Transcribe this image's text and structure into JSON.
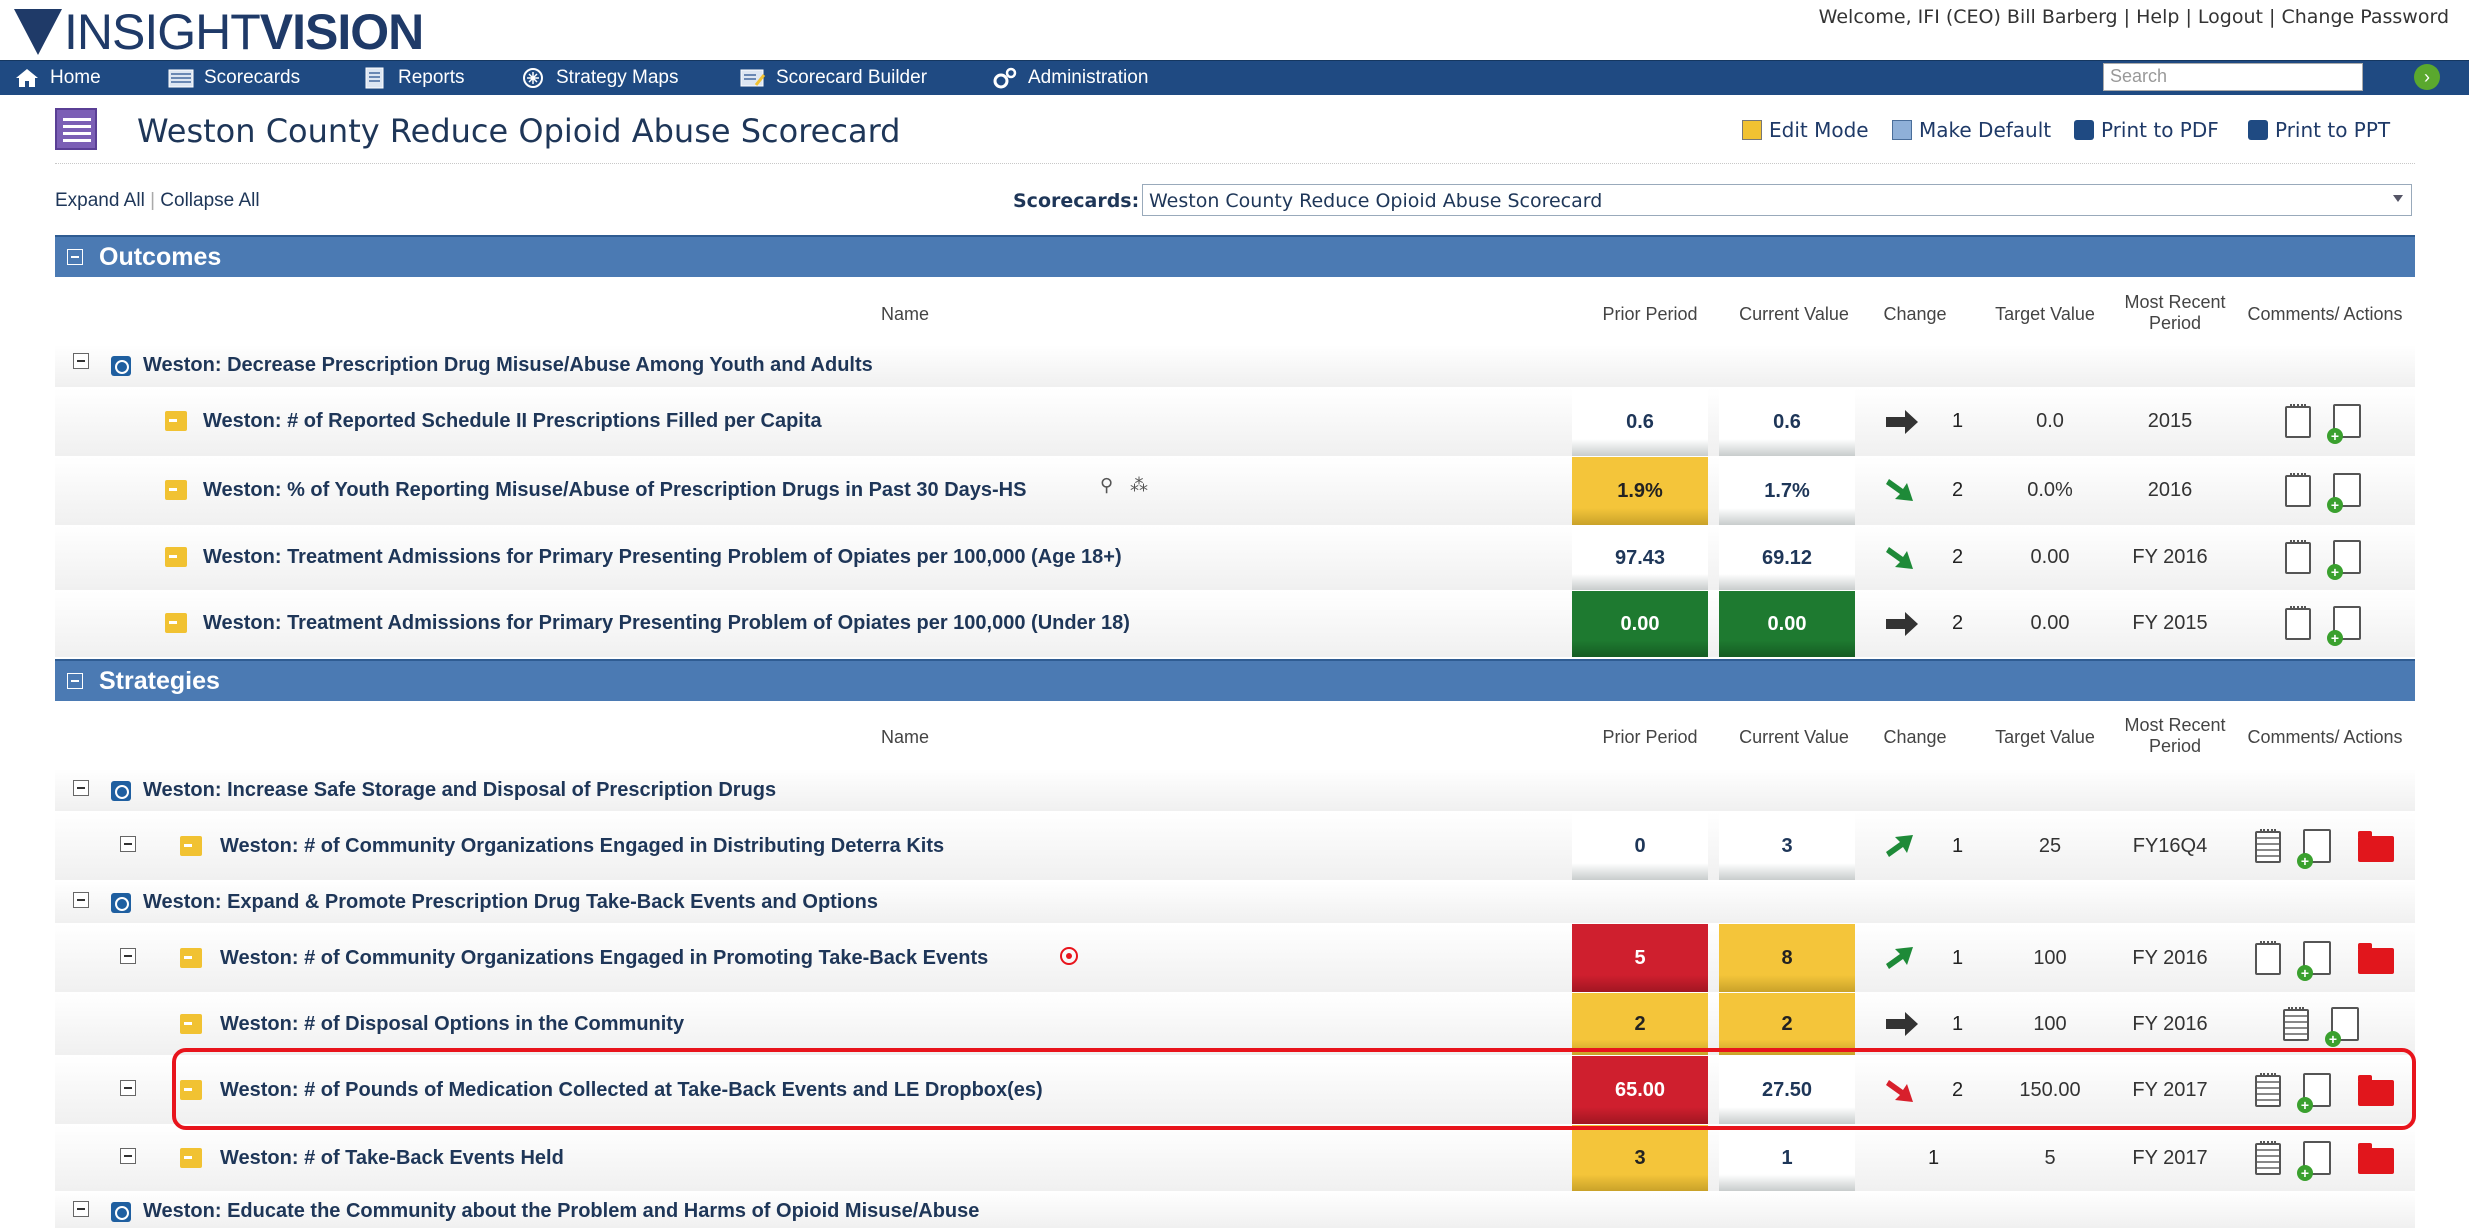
{
  "brand": {
    "logo_light": "INSIGHT",
    "logo_bold": "VISION"
  },
  "user": {
    "welcome": "Welcome, IFI (CEO) Bill Barberg",
    "help": "Help",
    "logout": "Logout",
    "change_password": "Change Password"
  },
  "nav": {
    "home": "Home",
    "scorecards": "Scorecards",
    "reports": "Reports",
    "strategy_maps": "Strategy Maps",
    "scorecard_builder": "Scorecard Builder",
    "administration": "Administration",
    "search_placeholder": "Search"
  },
  "page": {
    "title": "Weston County Reduce Opioid Abuse Scorecard",
    "edit_mode": "Edit Mode",
    "make_default": "Make Default",
    "print_pdf": "Print to PDF",
    "print_ppt": "Print to PPT"
  },
  "toolbar": {
    "expand_all": "Expand All",
    "collapse_all": "Collapse All",
    "scorecards_label": "Scorecards:",
    "scorecard_selected": "Weston County Reduce Opioid Abuse Scorecard"
  },
  "columns": {
    "name": "Name",
    "prior": "Prior Period",
    "current": "Current Value",
    "change": "Change",
    "target": "Target Value",
    "recent_1": "Most Recent",
    "recent_2": "Period",
    "comments": "Comments/ Actions"
  },
  "outcomes": {
    "title": "Outcomes",
    "goal": "Weston: Decrease Prescription Drug Misuse/Abuse Among Youth and Adults",
    "measures": [
      {
        "name": "Weston: # of Reported Schedule II Prescriptions Filled per Capita",
        "prior": "0.6",
        "current": "0.6",
        "change": "1",
        "target": "0.0",
        "period": "2015"
      },
      {
        "name": "Weston: % of Youth Reporting Misuse/Abuse of Prescription Drugs in Past 30 Days-HS",
        "prior": "1.9%",
        "current": "1.7%",
        "change": "2",
        "target": "0.0%",
        "period": "2016"
      },
      {
        "name": "Weston: Treatment Admissions for Primary Presenting Problem of Opiates per 100,000 (Age 18+)",
        "prior": "97.43",
        "current": "69.12",
        "change": "2",
        "target": "0.00",
        "period": "FY 2016"
      },
      {
        "name": "Weston: Treatment Admissions for Primary Presenting Problem of Opiates per 100,000 (Under 18)",
        "prior": "0.00",
        "current": "0.00",
        "change": "2",
        "target": "0.00",
        "period": "FY 2015"
      }
    ]
  },
  "strategies": {
    "title": "Strategies",
    "goal1": "Weston: Increase Safe Storage and Disposal of Prescription Drugs",
    "goal2": "Weston: Expand & Promote Prescription Drug Take-Back Events and Options",
    "goal3": "Weston: Educate the Community about the Problem and Harms of Opioid Misuse/Abuse",
    "measures": [
      {
        "name": "Weston: # of Community Organizations Engaged in Distributing Deterra Kits",
        "prior": "0",
        "current": "3",
        "change": "1",
        "target": "25",
        "period": "FY16Q4"
      },
      {
        "name": "Weston: # of Community Organizations Engaged in Promoting Take-Back Events",
        "prior": "5",
        "current": "8",
        "change": "1",
        "target": "100",
        "period": "FY 2016"
      },
      {
        "name": "Weston: # of Disposal Options in the Community",
        "prior": "2",
        "current": "2",
        "change": "1",
        "target": "100",
        "period": "FY 2016"
      },
      {
        "name": "Weston: # of Pounds of Medication Collected at Take-Back Events and LE Dropbox(es)",
        "prior": "65.00",
        "current": "27.50",
        "change": "2",
        "target": "150.00",
        "period": "FY 2017"
      },
      {
        "name": "Weston: # of Take-Back Events Held",
        "prior": "3",
        "current": "1",
        "change": "1",
        "target": "5",
        "period": "FY 2017"
      }
    ]
  },
  "colors": {
    "nav": "#1f4a82",
    "section": "#4b7ab3",
    "yellow": "#f4c53a",
    "green": "#1e7a30",
    "red": "#cf1f2e",
    "highlight": "#e8141c"
  }
}
